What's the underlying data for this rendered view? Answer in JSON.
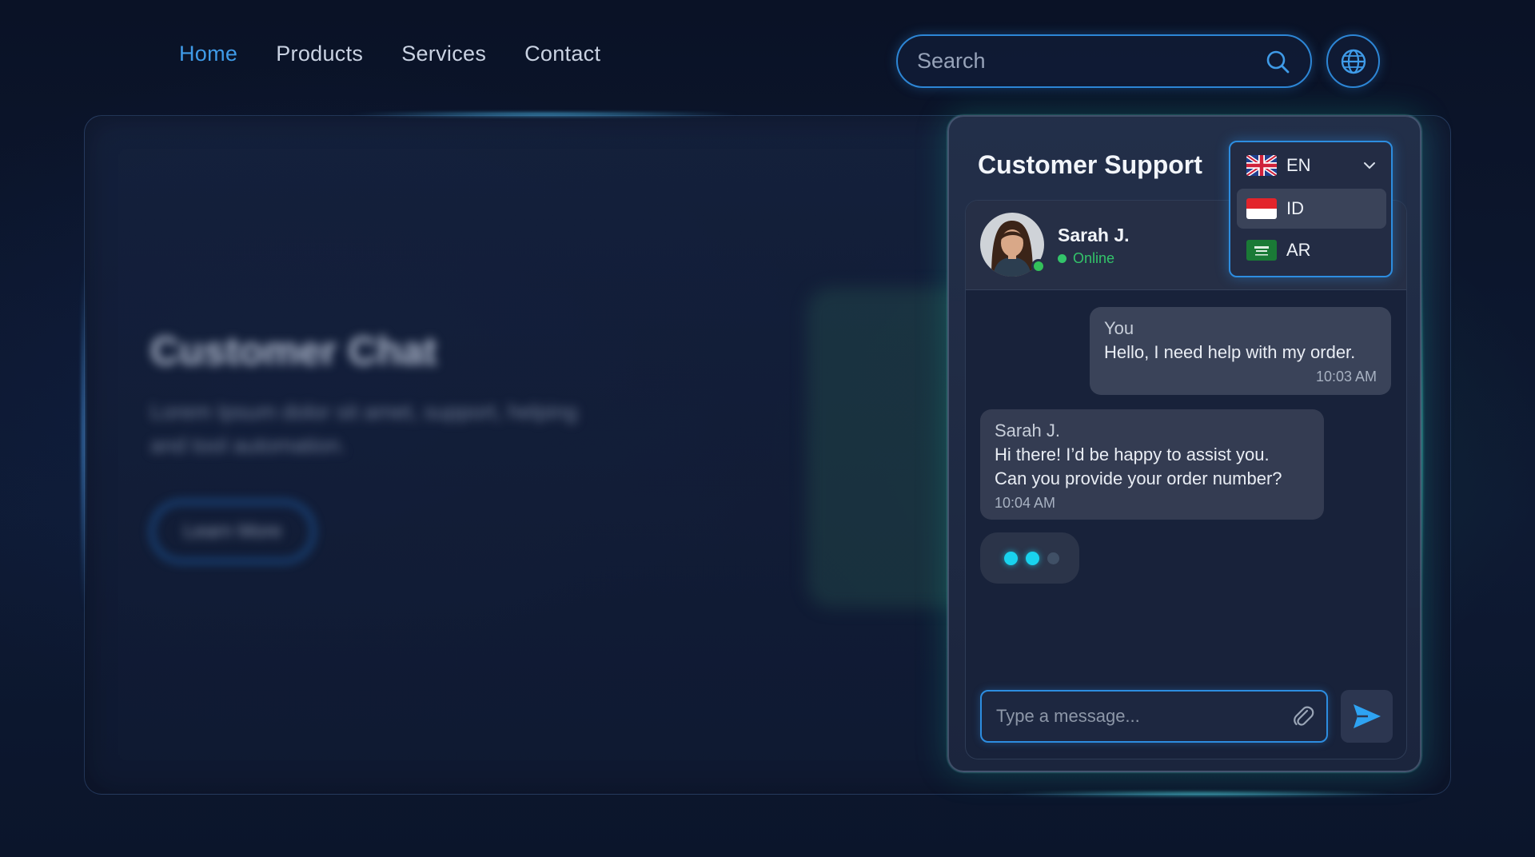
{
  "nav": {
    "items": [
      {
        "label": "Home",
        "active": true
      },
      {
        "label": "Products",
        "active": false
      },
      {
        "label": "Services",
        "active": false
      },
      {
        "label": "Contact",
        "active": false
      }
    ]
  },
  "search": {
    "placeholder": "Search",
    "icon": "search-icon"
  },
  "globe": {
    "icon": "globe-icon"
  },
  "hero": {
    "title": "Customer Chat",
    "subtitle": "Lorem Ipsum dolor sit amet, support, helping and tool automation.",
    "button_label": "Learn More"
  },
  "support": {
    "title": "Customer Support",
    "agent": {
      "name": "Sarah J.",
      "status": "Online"
    },
    "messages": [
      {
        "sender": "You",
        "text": "Hello, I need help with my order.",
        "time": "10:03 AM"
      },
      {
        "sender": "Sarah J.",
        "text_line1": "Hi there! I’d be happy to assist you.",
        "text_line2": "Can you provide your order number?",
        "time": "10:04 AM"
      }
    ],
    "input_placeholder": "Type a message...",
    "attach_icon": "paperclip-icon",
    "send_icon": "send-icon"
  },
  "language": {
    "selected": "EN",
    "options": [
      "ID",
      "AR"
    ]
  },
  "colors": {
    "accent": "#2d8de0",
    "nav_active": "#3f9be8",
    "online": "#33c46a",
    "typing_dot": "#19d3ee"
  }
}
